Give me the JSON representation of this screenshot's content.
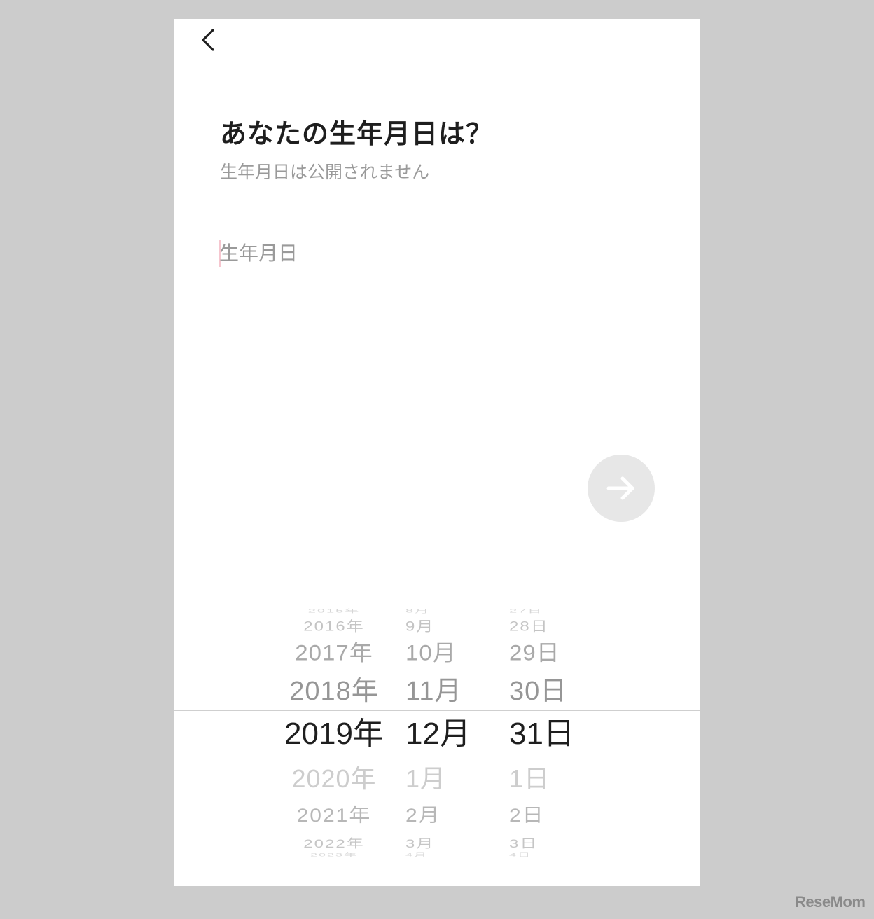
{
  "header": {
    "back_icon": "chevron-left-icon"
  },
  "form": {
    "title": "あなたの生年月日は？",
    "subtitle": "生年月日は公開されません",
    "birthday_placeholder": "生年月日",
    "next_icon": "arrow-right-icon"
  },
  "picker": {
    "years": [
      "2015年",
      "2016年",
      "2017年",
      "2018年",
      "2019年",
      "2020年",
      "2021年",
      "2022年",
      "2023年"
    ],
    "months": [
      "8月",
      "9月",
      "10月",
      "11月",
      "12月",
      "1月",
      "2月",
      "3月",
      "4月"
    ],
    "days": [
      "27日",
      "28日",
      "29日",
      "30日",
      "31日",
      "1日",
      "2日",
      "3日",
      "4日"
    ],
    "selected": {
      "year": "2019年",
      "month": "12月",
      "day": "31日"
    }
  },
  "watermark": "ReseMom"
}
